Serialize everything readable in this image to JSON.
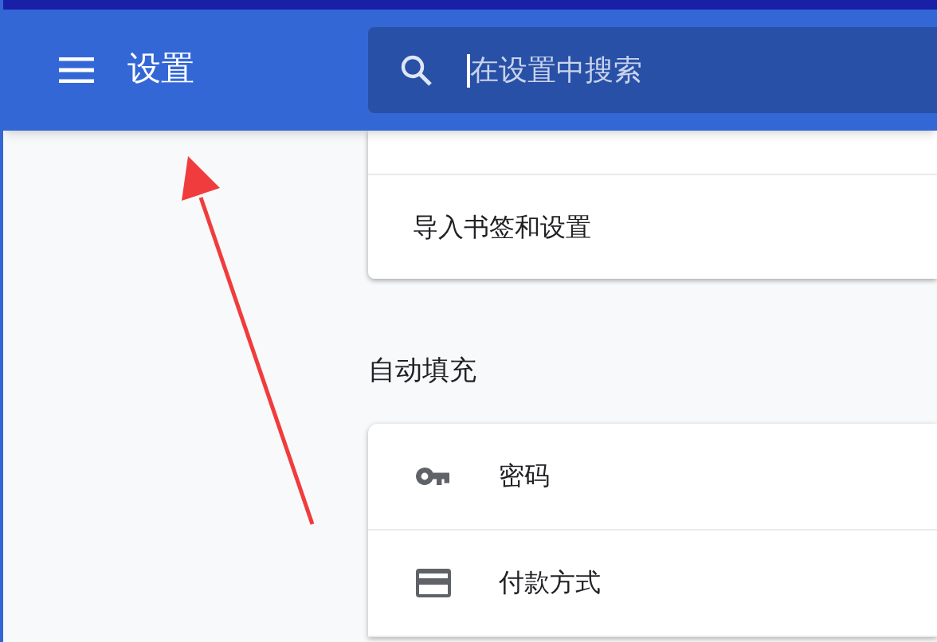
{
  "header": {
    "title": "设置",
    "search": {
      "placeholder": "在设置中搜索"
    }
  },
  "sections": [
    {
      "items": [
        {
          "label": "导入书签和设置",
          "kind": "plain"
        }
      ]
    },
    {
      "title": "自动填充",
      "items": [
        {
          "label": "密码",
          "kind": "key"
        },
        {
          "label": "付款方式",
          "kind": "card"
        }
      ]
    }
  ]
}
